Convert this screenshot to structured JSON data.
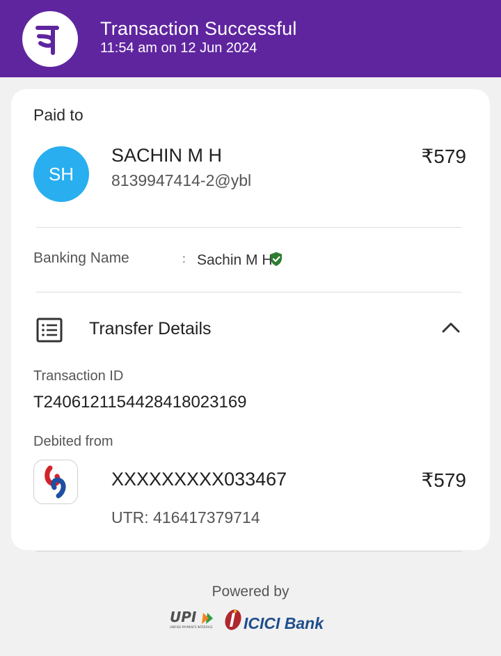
{
  "header": {
    "title": "Transaction Successful",
    "timestamp": "11:54 am on 12 Jun 2024",
    "brand_color": "#5f259f",
    "logo_icon": "phonepe-logo-icon"
  },
  "payee": {
    "section_label": "Paid to",
    "initials": "SH",
    "avatar_color": "#29aef0",
    "name": "SACHIN M H",
    "upi_id": "8139947414-2@ybl",
    "amount": "₹579"
  },
  "banking": {
    "label": "Banking Name",
    "separator": ":",
    "value": "Sachin M H",
    "verified_icon": "shield-check-icon",
    "verified_color": "#2e7d32"
  },
  "transfer": {
    "title": "Transfer Details",
    "icon": "document-list-icon",
    "toggle_icon": "chevron-up-icon",
    "transaction_id_label": "Transaction ID",
    "transaction_id": "T2406121154428418023169",
    "debited_from_label": "Debited from",
    "bank_icon": "canara-bank-logo-icon",
    "account_masked": "XXXXXXXXX033467",
    "amount": "₹579",
    "utr": "UTR: 416417379714"
  },
  "footer": {
    "powered_by": "Powered by",
    "upi_logo_text": "UPI",
    "upi_logo_subtext": "UNIFIED PAYMENTS INTERFACE",
    "bank_logo_text": "ICICI Bank",
    "upi_colors": [
      "#4f4f4f",
      "#f58220",
      "#2e9c45"
    ],
    "icici_color": "#1f4e8c",
    "icici_accent": "#ae282e"
  }
}
